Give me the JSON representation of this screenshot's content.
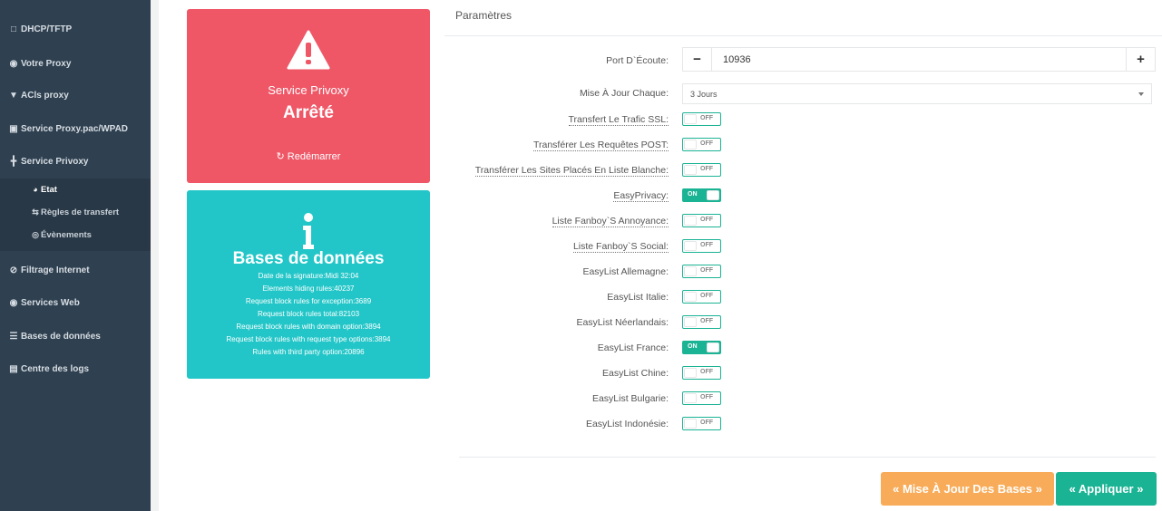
{
  "sidebar": {
    "items": [
      {
        "label": "DHCP/TFTP",
        "icon": "monitor-icon"
      },
      {
        "label": "Votre Proxy",
        "icon": "globe-icon"
      },
      {
        "label": "ACls proxy",
        "icon": "shield-icon"
      },
      {
        "label": "Service Proxy.pac/WPAD",
        "icon": "image-icon"
      },
      {
        "label": "Service Privoxy",
        "icon": "sitemap-icon"
      },
      {
        "label": "Filtrage Internet",
        "icon": "eye-slash-icon"
      },
      {
        "label": "Services Web",
        "icon": "globe-icon"
      },
      {
        "label": "Bases de données",
        "icon": "database-icon"
      },
      {
        "label": "Centre des logs",
        "icon": "file-icon"
      }
    ],
    "subitems": [
      {
        "label": "Etat",
        "icon": "dashboard-icon"
      },
      {
        "label": "Règles de transfert",
        "icon": "exchange-icon"
      },
      {
        "label": "Évènements",
        "icon": "eye-icon"
      }
    ]
  },
  "service_card": {
    "title": "Service Privoxy",
    "state": "Arrêté",
    "restart_label": "Redémarrer",
    "color": "#ef5767"
  },
  "db_card": {
    "title": "Bases de données",
    "color": "#23c6c8",
    "lines": [
      "Date de la signature:Midi 32:04",
      "Elements hiding rules:40237",
      "Request block rules for exception:3689",
      "Request block rules total:82103",
      "Request block rules with domain option:3894",
      "Request block rules with request type options:3894",
      "Rules with third party option:20896"
    ]
  },
  "params": {
    "title": "Paramètres",
    "port_label": "Port D`Écoute:",
    "port_value": "10936",
    "update_label": "Mise À Jour Chaque:",
    "update_value": "3 Jours",
    "toggles": [
      {
        "label": "Transfert Le Trafic SSL:",
        "state": "OFF",
        "dotted": true
      },
      {
        "label": "Transférer Les Requêtes POST:",
        "state": "OFF",
        "dotted": true
      },
      {
        "label": "Transférer Les Sites Placés En Liste Blanche:",
        "state": "OFF",
        "dotted": true
      },
      {
        "label": "EasyPrivacy:",
        "state": "ON",
        "dotted": true
      },
      {
        "label": "Liste Fanboy`S Annoyance:",
        "state": "OFF",
        "dotted": true
      },
      {
        "label": "Liste Fanboy`S Social:",
        "state": "OFF",
        "dotted": true
      },
      {
        "label": "EasyList Allemagne:",
        "state": "OFF",
        "dotted": false
      },
      {
        "label": "EasyList Italie:",
        "state": "OFF",
        "dotted": false
      },
      {
        "label": "EasyList Néerlandais:",
        "state": "OFF",
        "dotted": false
      },
      {
        "label": "EasyList France:",
        "state": "ON",
        "dotted": false
      },
      {
        "label": "EasyList Chine:",
        "state": "OFF",
        "dotted": false
      },
      {
        "label": "EasyList Bulgarie:",
        "state": "OFF",
        "dotted": false
      },
      {
        "label": "EasyList Indonésie:",
        "state": "OFF",
        "dotted": false
      }
    ]
  },
  "buttons": {
    "update_db": "« Mise À Jour Des Bases »",
    "apply": "« Appliquer »"
  },
  "colors": {
    "sidebar_bg": "#2f4050",
    "accent_green": "#1ab394",
    "warning_orange": "#f8ac59"
  }
}
